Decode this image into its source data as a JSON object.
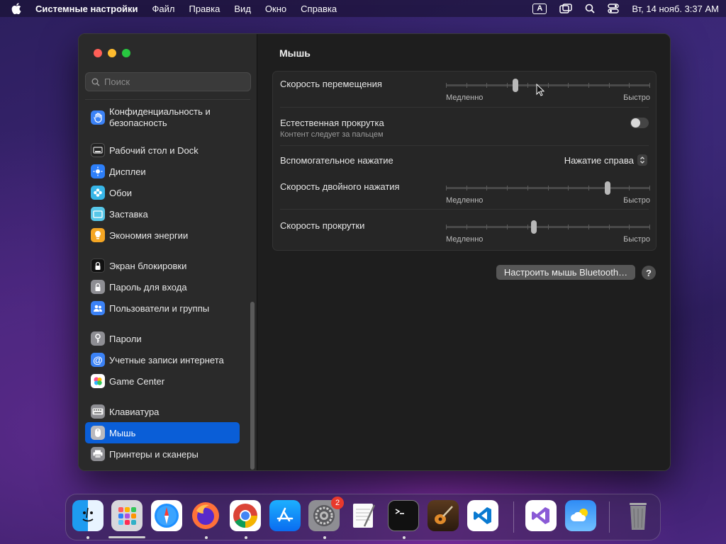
{
  "menubar": {
    "app_name": "Системные настройки",
    "items": [
      "Файл",
      "Правка",
      "Вид",
      "Окно",
      "Справка"
    ],
    "keyboard_layout": "A",
    "datetime": "Вт, 14 нояб.  3:37 AM"
  },
  "search": {
    "placeholder": "Поиск"
  },
  "sidebar": {
    "items": [
      {
        "label": "Конфиденциальность и безопасность",
        "icon": "hand-icon",
        "color": "#3b82f6"
      },
      {
        "label": "Рабочий стол и Dock",
        "icon": "dock-icon",
        "color": "#222222"
      },
      {
        "label": "Дисплеи",
        "icon": "sun-icon",
        "color": "#2d7ff9"
      },
      {
        "label": "Обои",
        "icon": "flower-icon",
        "color": "#38b6e8"
      },
      {
        "label": "Заставка",
        "icon": "screensaver-icon",
        "color": "#57c7e8"
      },
      {
        "label": "Экономия энергии",
        "icon": "bulb-icon",
        "color": "#f5a623"
      },
      {
        "label": "Экран блокировки",
        "icon": "lock-icon",
        "color": "#111111"
      },
      {
        "label": "Пароль для входа",
        "icon": "padlock-icon",
        "color": "#8e8e93"
      },
      {
        "label": "Пользователи и группы",
        "icon": "users-icon",
        "color": "#3b82f6"
      },
      {
        "label": "Пароли",
        "icon": "key-icon",
        "color": "#8e8e93"
      },
      {
        "label": "Учетные записи интернета",
        "icon": "at-icon",
        "color": "#3b82f6"
      },
      {
        "label": "Game Center",
        "icon": "game-center-icon",
        "color": "#ffffff"
      },
      {
        "label": "Клавиатура",
        "icon": "keyboard-icon",
        "color": "#8e8e93"
      },
      {
        "label": "Мышь",
        "icon": "mouse-icon",
        "color": "#8e8e93"
      },
      {
        "label": "Принтеры и сканеры",
        "icon": "printer-icon",
        "color": "#8e8e93"
      }
    ],
    "active": "Мышь"
  },
  "main": {
    "title": "Мышь",
    "tracking_speed": {
      "label": "Скорость перемещения",
      "min_label": "Медленно",
      "max_label": "Быстро",
      "value": 0.34
    },
    "natural_scrolling": {
      "label": "Естественная прокрутка",
      "sublabel": "Контент следует за пальцем",
      "enabled": false
    },
    "secondary_click": {
      "label": "Вспомогательное нажатие",
      "value": "Нажатие справа"
    },
    "double_click_speed": {
      "label": "Скорость двойного нажатия",
      "min_label": "Медленно",
      "max_label": "Быстро",
      "value": 0.79
    },
    "scroll_speed": {
      "label": "Скорость прокрутки",
      "min_label": "Медленно",
      "max_label": "Быстро",
      "value": 0.43
    },
    "bluetooth_button": "Настроить мышь Bluetooth…",
    "help_button": "?"
  },
  "dock": {
    "apps": [
      "Finder",
      "Launchpad",
      "Safari",
      "Firefox",
      "Chrome",
      "App Store",
      "Системные настройки",
      "TextEdit",
      "Terminal",
      "GarageBand",
      "VS Code",
      "Visual Studio",
      "Weather",
      "Trash"
    ],
    "settings_badge": "2"
  }
}
